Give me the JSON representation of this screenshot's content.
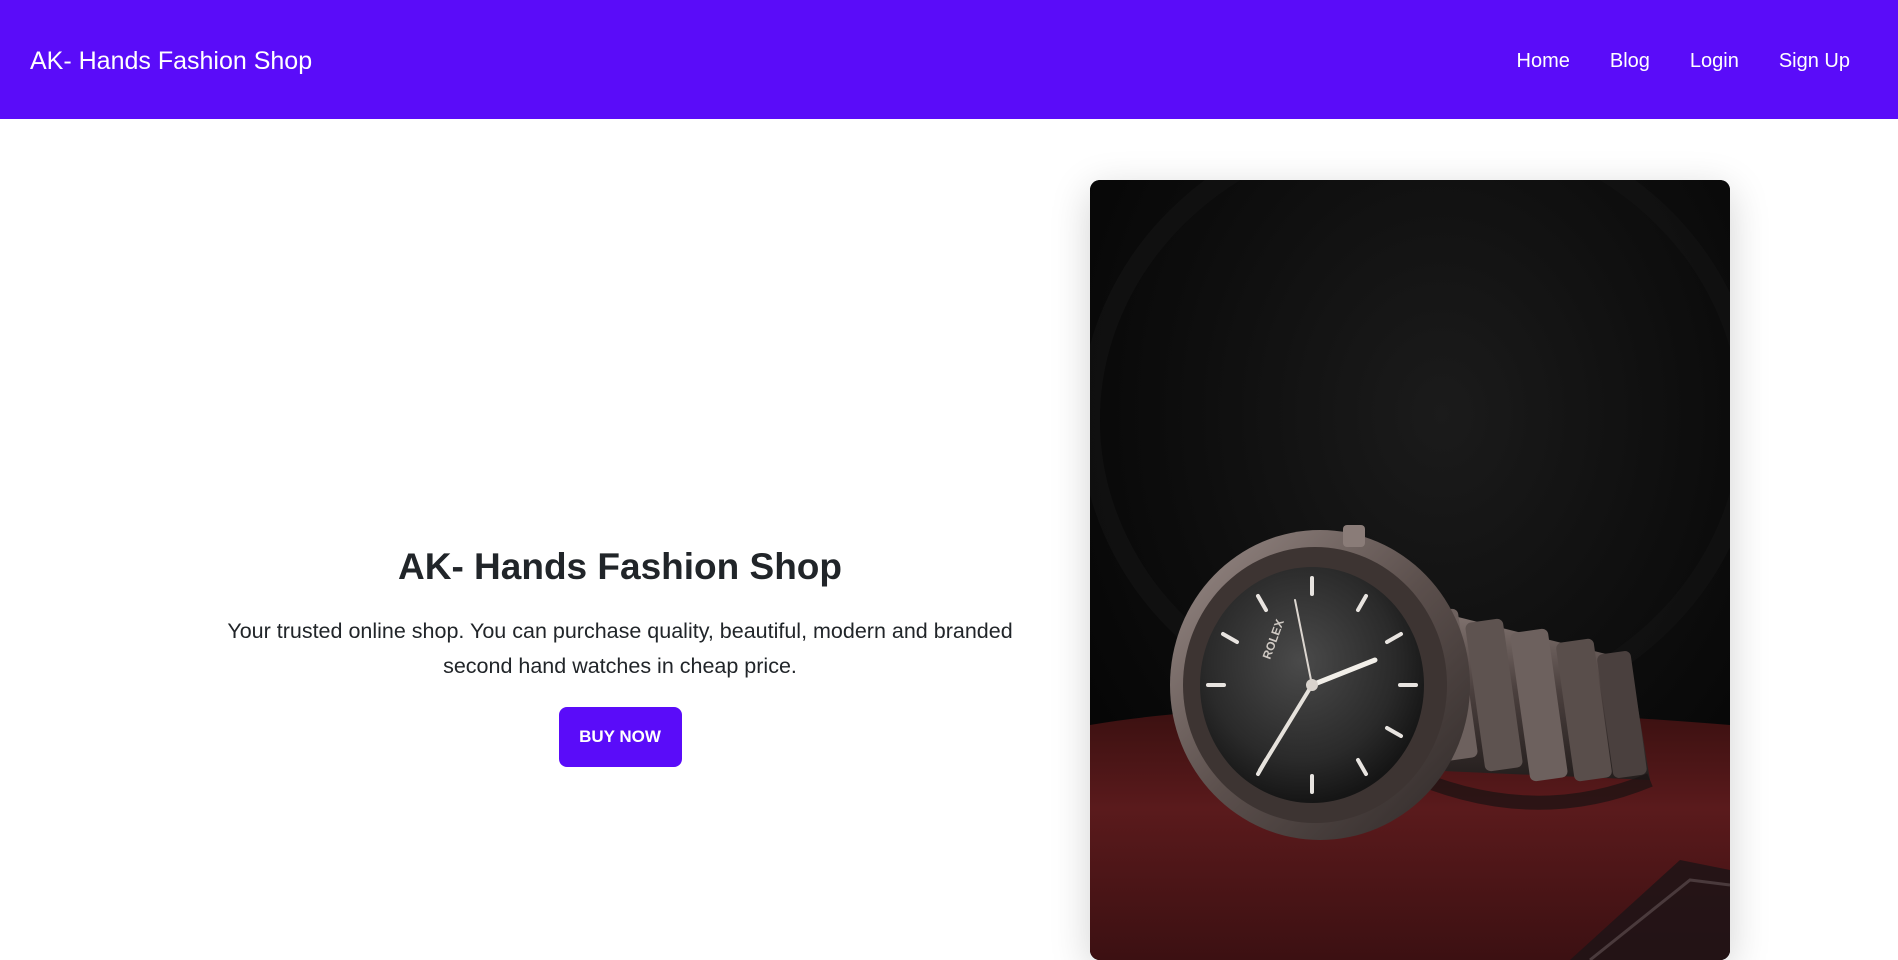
{
  "navbar": {
    "brand": "AK- Hands Fashion Shop",
    "links": [
      {
        "label": "Home"
      },
      {
        "label": "Blog"
      },
      {
        "label": "Login"
      },
      {
        "label": "Sign Up"
      }
    ],
    "background_color": "#5a0cf9"
  },
  "hero": {
    "title": "AK- Hands Fashion Shop",
    "description": "Your trusted online shop. You can purchase quality, beautiful, modern and branded second hand watches in cheap price.",
    "cta_label": "BUY NOW",
    "cta_color": "#5a0cf9"
  },
  "product_image": {
    "subject": "luxury wristwatch on red book",
    "watch_brand_text": "ROLEX"
  }
}
